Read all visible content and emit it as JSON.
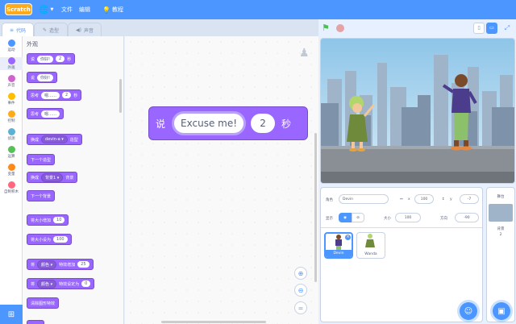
{
  "menubar": {
    "logo": "Scratch",
    "file_label": "文件",
    "edit_label": "编辑",
    "tutorials_label": "教程"
  },
  "tabs": {
    "code_label": "代码",
    "costumes_label": "造型",
    "sounds_label": "声音"
  },
  "categories": [
    {
      "label": "运动",
      "color": "#4c97ff"
    },
    {
      "label": "外观",
      "color": "#9966ff"
    },
    {
      "label": "声音",
      "color": "#cf63cf"
    },
    {
      "label": "事件",
      "color": "#ffbf00"
    },
    {
      "label": "控制",
      "color": "#ffab19"
    },
    {
      "label": "侦测",
      "color": "#5cb1d6"
    },
    {
      "label": "运算",
      "color": "#59c059"
    },
    {
      "label": "变量",
      "color": "#ff8c1a"
    },
    {
      "label": "自制积木",
      "color": "#ff6680"
    }
  ],
  "flyout": {
    "title": "外观",
    "blocks": {
      "say_for_secs": {
        "say": "说",
        "text": "你好!",
        "secs": "2",
        "unit": "秒"
      },
      "say": {
        "say": "说",
        "text": "你好!"
      },
      "think_for_secs": {
        "think": "思考",
        "text": "嗯……",
        "secs": "2",
        "unit": "秒"
      },
      "think": {
        "think": "思考",
        "text": "嗯……"
      },
      "switch_costume": {
        "prefix": "换成",
        "value": "devin-a",
        "suffix": "造型"
      },
      "next_costume": {
        "label": "下一个造型"
      },
      "switch_backdrop": {
        "prefix": "换成",
        "value": "背景1",
        "suffix": "背景"
      },
      "next_backdrop": {
        "label": "下一个背景"
      },
      "change_size": {
        "label": "将大小增加",
        "value": "10"
      },
      "set_size": {
        "label": "将大小设为",
        "value": "100"
      },
      "change_effect": {
        "prefix": "将",
        "effect": "颜色",
        "label": "特效增加",
        "value": "25"
      },
      "set_effect": {
        "prefix": "将",
        "effect": "颜色",
        "label": "特效设定为",
        "value": "0"
      },
      "clear_effects": {
        "label": "清除图形特效"
      }
    }
  },
  "workspace": {
    "say_block": {
      "say": "说",
      "text": "Excuse me!",
      "secs": "2",
      "unit": "秒"
    },
    "zoom_reset": "="
  },
  "sprite_info": {
    "sprite_label": "角色",
    "sprite_name": "Devin",
    "x_label": "x",
    "x": "100",
    "y_label": "y",
    "y": "-7",
    "show_label": "显示",
    "size_label": "大小",
    "size": "100",
    "direction_label": "方向",
    "direction": "-90"
  },
  "sprites": [
    {
      "name": "Devin",
      "selected": true
    },
    {
      "name": "Wanda",
      "selected": false
    }
  ],
  "stage_pane": {
    "title": "舞台",
    "backdrops_label": "背景",
    "backdrops_count": "2"
  }
}
